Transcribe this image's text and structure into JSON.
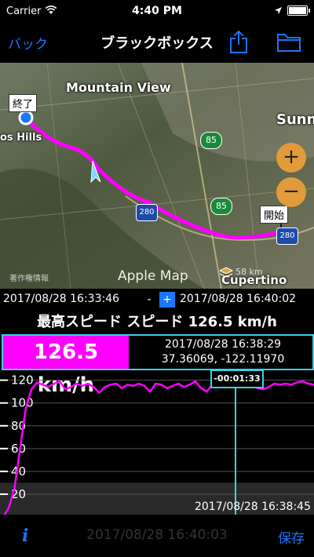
{
  "status": {
    "carrier": "Carrier",
    "time": "4:40 PM"
  },
  "nav": {
    "back": "バック",
    "title": "ブラックボックス"
  },
  "map": {
    "labels": {
      "mountain_view": "Mountain View",
      "los_hills": "os Hills",
      "sunn": "Sunn",
      "cupertino": "Cupertino",
      "hw85a": "85",
      "hw85b": "85",
      "hw280a": "280",
      "hw280b": "280"
    },
    "end_pin": "終了",
    "start_pin": "開始",
    "zoom_in": "+",
    "zoom_out": "−",
    "attribution": "Apple Map",
    "legal": "著作権情報",
    "scale": "58 km"
  },
  "range": {
    "start": "2017/08/28 16:33:46",
    "minus": "-",
    "plus": "+",
    "end": "2017/08/28 16:40:02"
  },
  "max_speed": "最高スピード スピード 126.5 km/h",
  "current": {
    "speed": "126.5 km/h",
    "timestamp": "2017/08/28 16:38:29",
    "coords": "37.36069, -122.11970"
  },
  "chart_data": {
    "type": "line",
    "y_ticks": [
      "120",
      "100",
      "80",
      "60",
      "40",
      "20"
    ],
    "ylim": [
      0,
      128
    ],
    "cursor_label": "-00:01:33",
    "cursor_time": "2017/08/28 16:38:45",
    "series": [
      {
        "values": [
          0,
          8,
          25,
          60,
          95,
          112,
          118,
          116,
          114,
          117,
          119,
          112,
          114,
          117,
          115,
          117,
          114,
          109,
          114,
          116,
          117,
          113,
          116,
          115,
          117,
          115,
          110,
          117,
          116,
          113,
          115,
          117,
          114,
          116,
          119,
          113,
          110,
          116,
          117,
          114,
          117,
          118,
          117,
          116,
          115,
          113,
          112,
          114,
          117,
          116,
          117,
          116,
          118,
          119,
          117,
          116
        ]
      }
    ],
    "colors": {
      "line": "#ff00ff",
      "cursor": "#39d2e6"
    }
  },
  "bottom": {
    "info": "i",
    "time": "2017/08/28 16:40:03",
    "save": "保存"
  }
}
